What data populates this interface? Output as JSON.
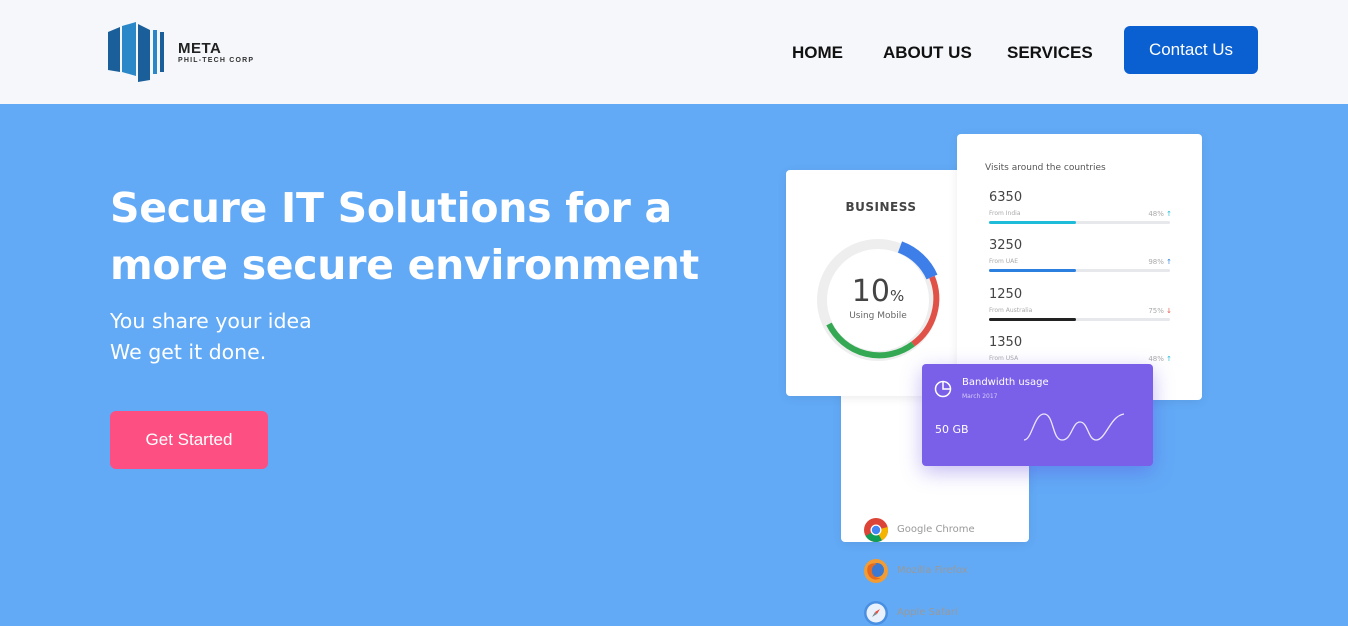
{
  "header": {
    "logo_main": "META",
    "logo_sub": "PHIL-TECH CORP",
    "nav": [
      "HOME",
      "ABOUT US",
      "SERVICES"
    ],
    "contact_label": "Contact Us"
  },
  "hero": {
    "title": "Secure IT Solutions for a more secure environment",
    "subtitle_line1": "You share your idea",
    "subtitle_line2": "We get it done.",
    "cta_label": "Get Started"
  },
  "business": {
    "title": "BUSINESS",
    "value": "10",
    "unit": "%",
    "label": "Using Mobile"
  },
  "visits": {
    "title": "Visits around the countries",
    "rows": [
      {
        "value": "6350",
        "from": "From India",
        "pct": "48%",
        "fill": 0.48,
        "color": "#1fbcd9",
        "trend": "up"
      },
      {
        "value": "3250",
        "from": "From UAE",
        "pct": "98%",
        "fill": 0.48,
        "color": "#2b7fde",
        "trend": "up"
      },
      {
        "value": "1250",
        "from": "From Australia",
        "pct": "75%",
        "fill": 0.48,
        "color": "#222222",
        "trend": "down"
      },
      {
        "value": "1350",
        "from": "From USA",
        "pct": "48%",
        "fill": 0.48,
        "color": "#1fbcd9",
        "trend": "up"
      }
    ]
  },
  "browsers": [
    {
      "name": "Google Chrome",
      "icon": "chrome-icon"
    },
    {
      "name": "Mozilla Firefox",
      "icon": "firefox-icon"
    },
    {
      "name": "Apple Safari",
      "icon": "safari-icon"
    }
  ],
  "bandwidth": {
    "title": "Bandwidth usage",
    "date": "March 2017",
    "value": "50 GB"
  },
  "colors": {
    "header_bg": "#f5f7fa",
    "hero_bg": "#62aaf6",
    "contact_btn": "#0a5fd1",
    "cta_btn": "#fd4f82",
    "bandwidth_bg": "#7a5fe8"
  }
}
